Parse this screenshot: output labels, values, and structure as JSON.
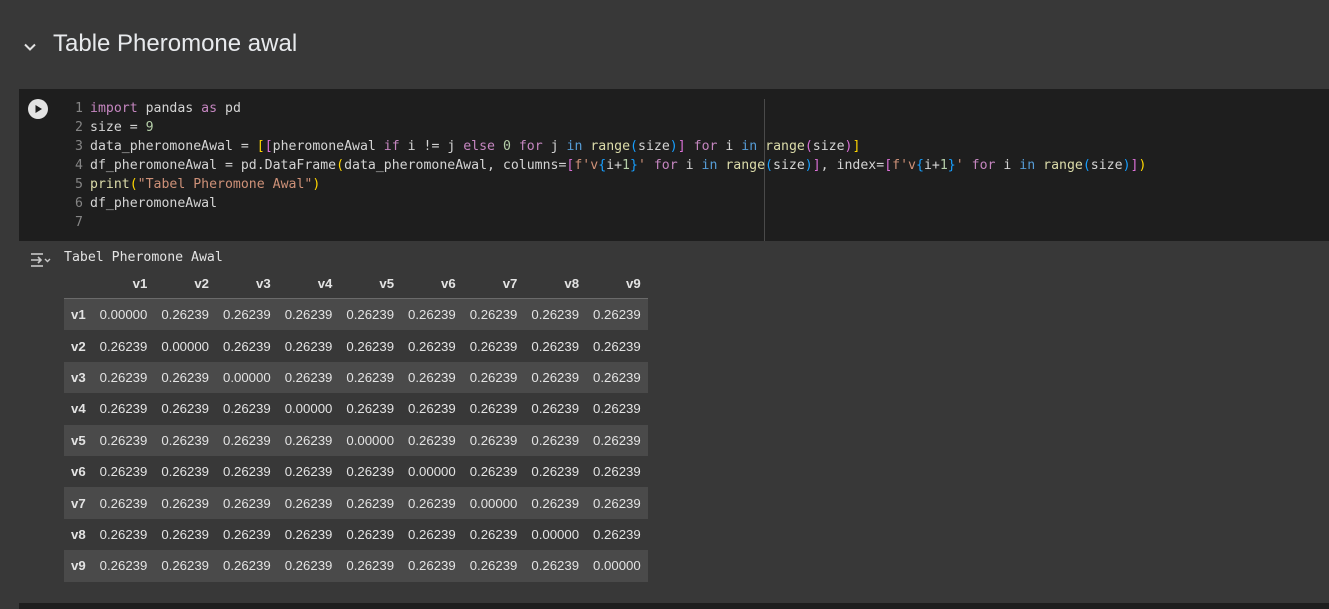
{
  "section": {
    "title": "Table Pheromone awal"
  },
  "code": {
    "line_numbers": [
      "1",
      "2",
      "3",
      "4",
      "5",
      "6",
      "7"
    ]
  },
  "output": {
    "stdout": "Tabel Pheromone Awal",
    "columns": [
      "v1",
      "v2",
      "v3",
      "v4",
      "v5",
      "v6",
      "v7",
      "v8",
      "v9"
    ],
    "rows": [
      {
        "index": "v1",
        "values": [
          "0.00000",
          "0.26239",
          "0.26239",
          "0.26239",
          "0.26239",
          "0.26239",
          "0.26239",
          "0.26239",
          "0.26239"
        ]
      },
      {
        "index": "v2",
        "values": [
          "0.26239",
          "0.00000",
          "0.26239",
          "0.26239",
          "0.26239",
          "0.26239",
          "0.26239",
          "0.26239",
          "0.26239"
        ]
      },
      {
        "index": "v3",
        "values": [
          "0.26239",
          "0.26239",
          "0.00000",
          "0.26239",
          "0.26239",
          "0.26239",
          "0.26239",
          "0.26239",
          "0.26239"
        ]
      },
      {
        "index": "v4",
        "values": [
          "0.26239",
          "0.26239",
          "0.26239",
          "0.00000",
          "0.26239",
          "0.26239",
          "0.26239",
          "0.26239",
          "0.26239"
        ]
      },
      {
        "index": "v5",
        "values": [
          "0.26239",
          "0.26239",
          "0.26239",
          "0.26239",
          "0.00000",
          "0.26239",
          "0.26239",
          "0.26239",
          "0.26239"
        ]
      },
      {
        "index": "v6",
        "values": [
          "0.26239",
          "0.26239",
          "0.26239",
          "0.26239",
          "0.26239",
          "0.00000",
          "0.26239",
          "0.26239",
          "0.26239"
        ]
      },
      {
        "index": "v7",
        "values": [
          "0.26239",
          "0.26239",
          "0.26239",
          "0.26239",
          "0.26239",
          "0.26239",
          "0.00000",
          "0.26239",
          "0.26239"
        ]
      },
      {
        "index": "v8",
        "values": [
          "0.26239",
          "0.26239",
          "0.26239",
          "0.26239",
          "0.26239",
          "0.26239",
          "0.26239",
          "0.00000",
          "0.26239"
        ]
      },
      {
        "index": "v9",
        "values": [
          "0.26239",
          "0.26239",
          "0.26239",
          "0.26239",
          "0.26239",
          "0.26239",
          "0.26239",
          "0.26239",
          "0.00000"
        ]
      }
    ]
  },
  "icons": {
    "collapse": "chevron-down-icon",
    "run": "play-icon",
    "output_toggle": "output-icon"
  },
  "colors": {
    "background": "#383838",
    "editor_bg": "#1e1e1e",
    "keyword": "#c586c0",
    "builtin": "#dcdcaa",
    "string": "#ce9178",
    "number": "#b5cea8"
  }
}
